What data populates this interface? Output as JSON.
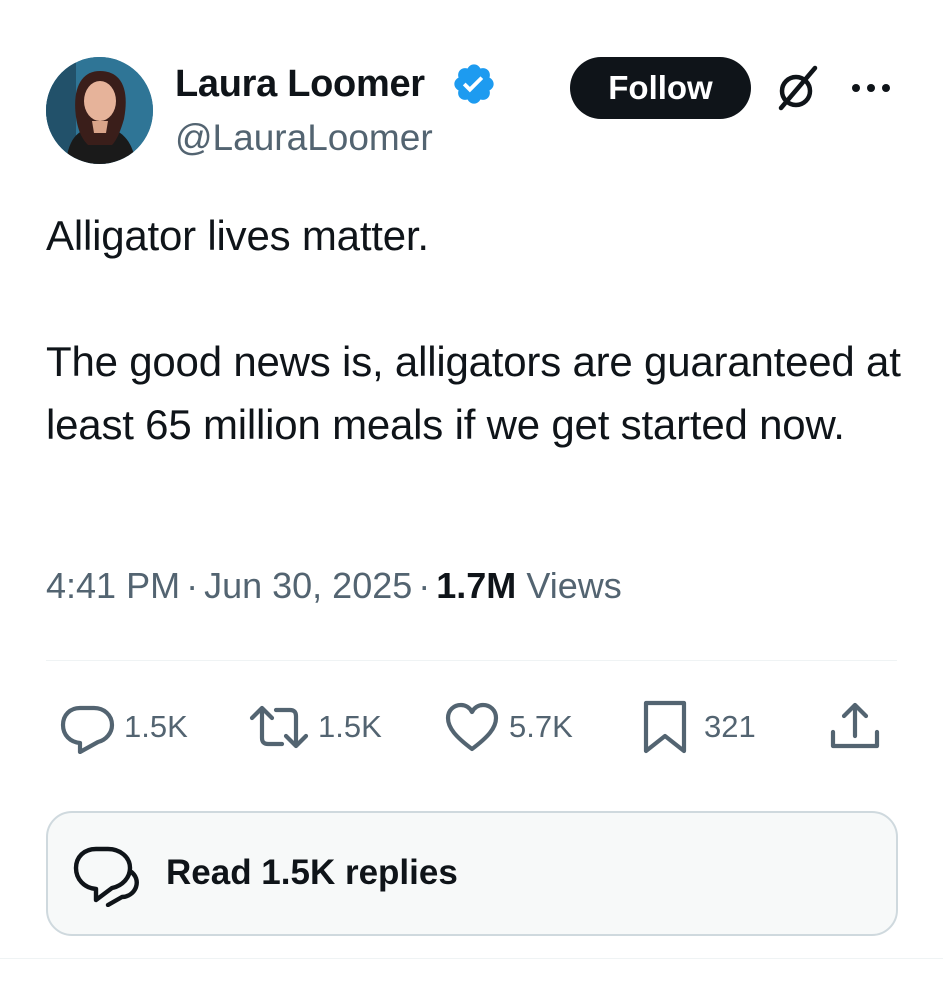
{
  "author": {
    "display_name": "Laura Loomer",
    "handle": "@LauraLoomer",
    "verified": true
  },
  "header": {
    "follow_label": "Follow"
  },
  "tweet": {
    "paragraphs": [
      "Alligator lives matter.",
      "The good news is, alligators are guaranteed at least 65 million meals if we get started now."
    ],
    "time": "4:41 PM",
    "date": "Jun 30, 2025",
    "views_count": "1.7M",
    "views_label": "Views",
    "separator": "·"
  },
  "actions": {
    "replies": "1.5K",
    "reposts": "1.5K",
    "likes": "5.7K",
    "bookmarks": "321"
  },
  "replies_cta": {
    "label": "Read 1.5K replies"
  },
  "colors": {
    "text_primary": "#0f1419",
    "text_secondary": "#536471",
    "verified_blue": "#1d9bf0",
    "follow_bg": "#0f1419",
    "divider": "#eff3f4"
  },
  "icons": {
    "verified": "verified-badge-icon",
    "grok": "grok-icon",
    "more": "more-icon",
    "reply": "reply-icon",
    "repost": "repost-icon",
    "like": "heart-icon",
    "bookmark": "bookmark-icon",
    "share": "share-icon",
    "replies_cta": "reply-bubble-icon"
  }
}
